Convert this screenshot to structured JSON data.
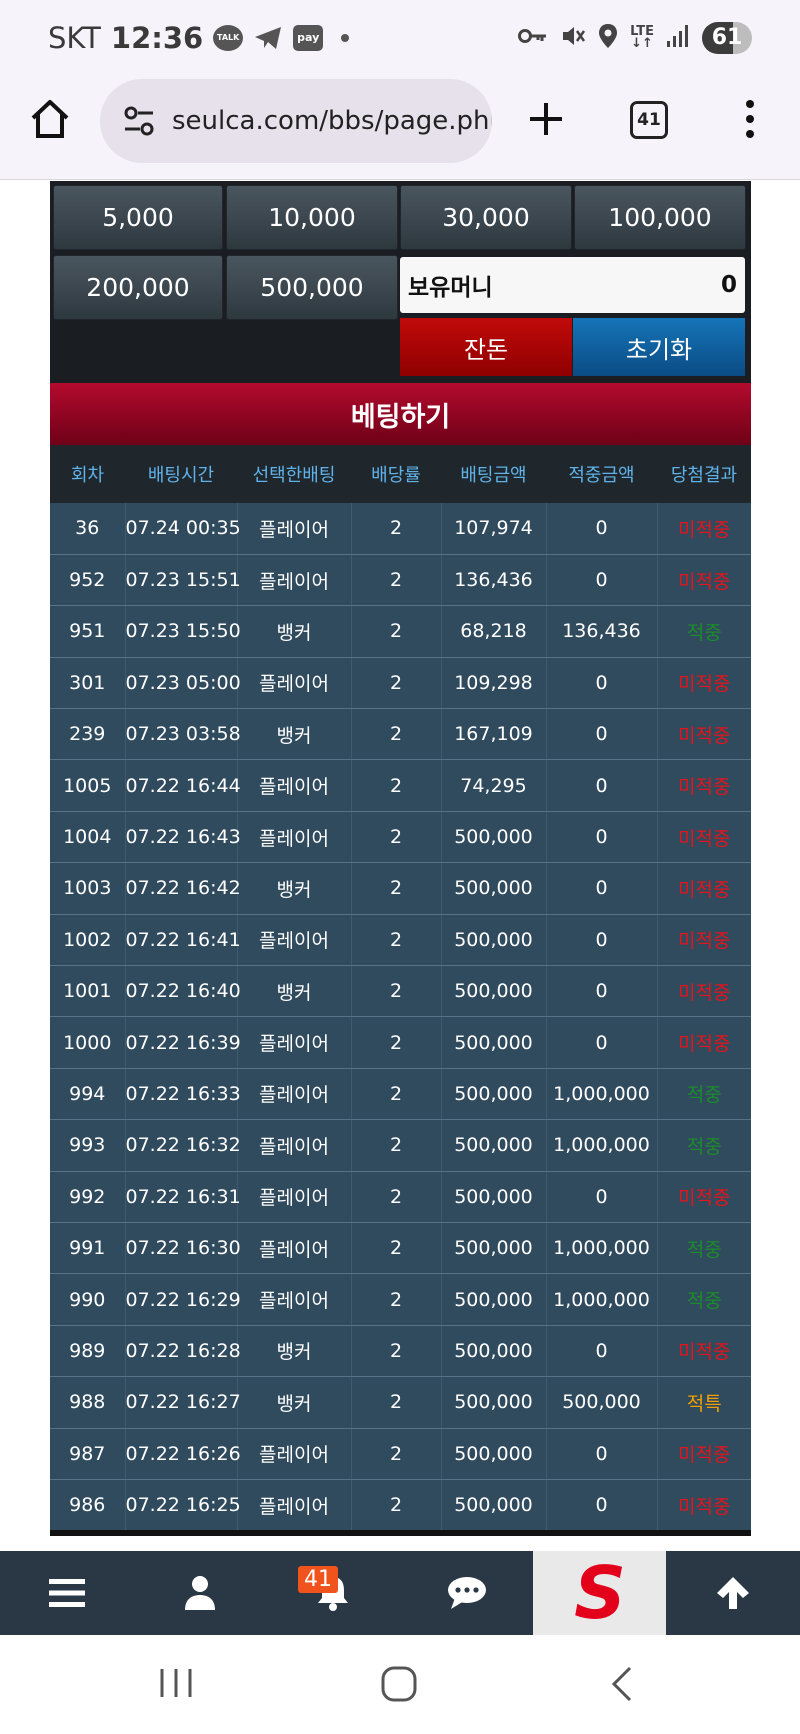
{
  "status_bar": {
    "carrier": "SKT",
    "time": "12:36",
    "talk_label": "TALK",
    "pay_label": "pay",
    "lte_top": "LTE",
    "lte_bottom": "↓↑",
    "battery_percent": "61",
    "battery_level": 0.61
  },
  "browser": {
    "url": "seulca.com/bbs/page.php",
    "tab_count": "41"
  },
  "bet_panel": {
    "chips": [
      "5,000",
      "10,000",
      "30,000",
      "100,000",
      "200,000",
      "500,000"
    ],
    "money_label": "보유머니",
    "money_value": "0",
    "change_label": "잔돈",
    "reset_label": "초기화",
    "bet_title": "베팅하기"
  },
  "history": {
    "columns": [
      "회차",
      "배팅시간",
      "선택한배팅",
      "배당률",
      "배팅금액",
      "적중금액",
      "당첨결과"
    ],
    "rows": [
      [
        "36",
        "07.24 00:35",
        "플레이어",
        "2",
        "107,974",
        "0",
        "미적중"
      ],
      [
        "952",
        "07.23 15:51",
        "플레이어",
        "2",
        "136,436",
        "0",
        "미적중"
      ],
      [
        "951",
        "07.23 15:50",
        "뱅커",
        "2",
        "68,218",
        "136,436",
        "적중"
      ],
      [
        "301",
        "07.23 05:00",
        "플레이어",
        "2",
        "109,298",
        "0",
        "미적중"
      ],
      [
        "239",
        "07.23 03:58",
        "뱅커",
        "2",
        "167,109",
        "0",
        "미적중"
      ],
      [
        "1005",
        "07.22 16:44",
        "플레이어",
        "2",
        "74,295",
        "0",
        "미적중"
      ],
      [
        "1004",
        "07.22 16:43",
        "플레이어",
        "2",
        "500,000",
        "0",
        "미적중"
      ],
      [
        "1003",
        "07.22 16:42",
        "뱅커",
        "2",
        "500,000",
        "0",
        "미적중"
      ],
      [
        "1002",
        "07.22 16:41",
        "플레이어",
        "2",
        "500,000",
        "0",
        "미적중"
      ],
      [
        "1001",
        "07.22 16:40",
        "뱅커",
        "2",
        "500,000",
        "0",
        "미적중"
      ],
      [
        "1000",
        "07.22 16:39",
        "플레이어",
        "2",
        "500,000",
        "0",
        "미적중"
      ],
      [
        "994",
        "07.22 16:33",
        "플레이어",
        "2",
        "500,000",
        "1,000,000",
        "적중"
      ],
      [
        "993",
        "07.22 16:32",
        "플레이어",
        "2",
        "500,000",
        "1,000,000",
        "적중"
      ],
      [
        "992",
        "07.22 16:31",
        "플레이어",
        "2",
        "500,000",
        "0",
        "미적중"
      ],
      [
        "991",
        "07.22 16:30",
        "플레이어",
        "2",
        "500,000",
        "1,000,000",
        "적중"
      ],
      [
        "990",
        "07.22 16:29",
        "플레이어",
        "2",
        "500,000",
        "1,000,000",
        "적중"
      ],
      [
        "989",
        "07.22 16:28",
        "뱅커",
        "2",
        "500,000",
        "0",
        "미적중"
      ],
      [
        "988",
        "07.22 16:27",
        "뱅커",
        "2",
        "500,000",
        "500,000",
        "적특"
      ],
      [
        "987",
        "07.22 16:26",
        "플레이어",
        "2",
        "500,000",
        "0",
        "미적중"
      ],
      [
        "986",
        "07.22 16:25",
        "플레이어",
        "2",
        "500,000",
        "0",
        "미적중"
      ]
    ],
    "result_colors": {
      "미적중": "#e4141b",
      "적중": "#1c8c2a",
      "적특": "#f0a000"
    }
  },
  "bottom_nav": {
    "notification_count": "41",
    "logo_letter": "S",
    "icons": [
      "menu-icon",
      "user-icon",
      "bell-icon",
      "chat-icon",
      "site-logo",
      "arrow-up-icon"
    ]
  },
  "colors": {
    "header_red": "#b40a2e",
    "row_bg": "#304a5e",
    "column_header": "#5fb3ea"
  }
}
